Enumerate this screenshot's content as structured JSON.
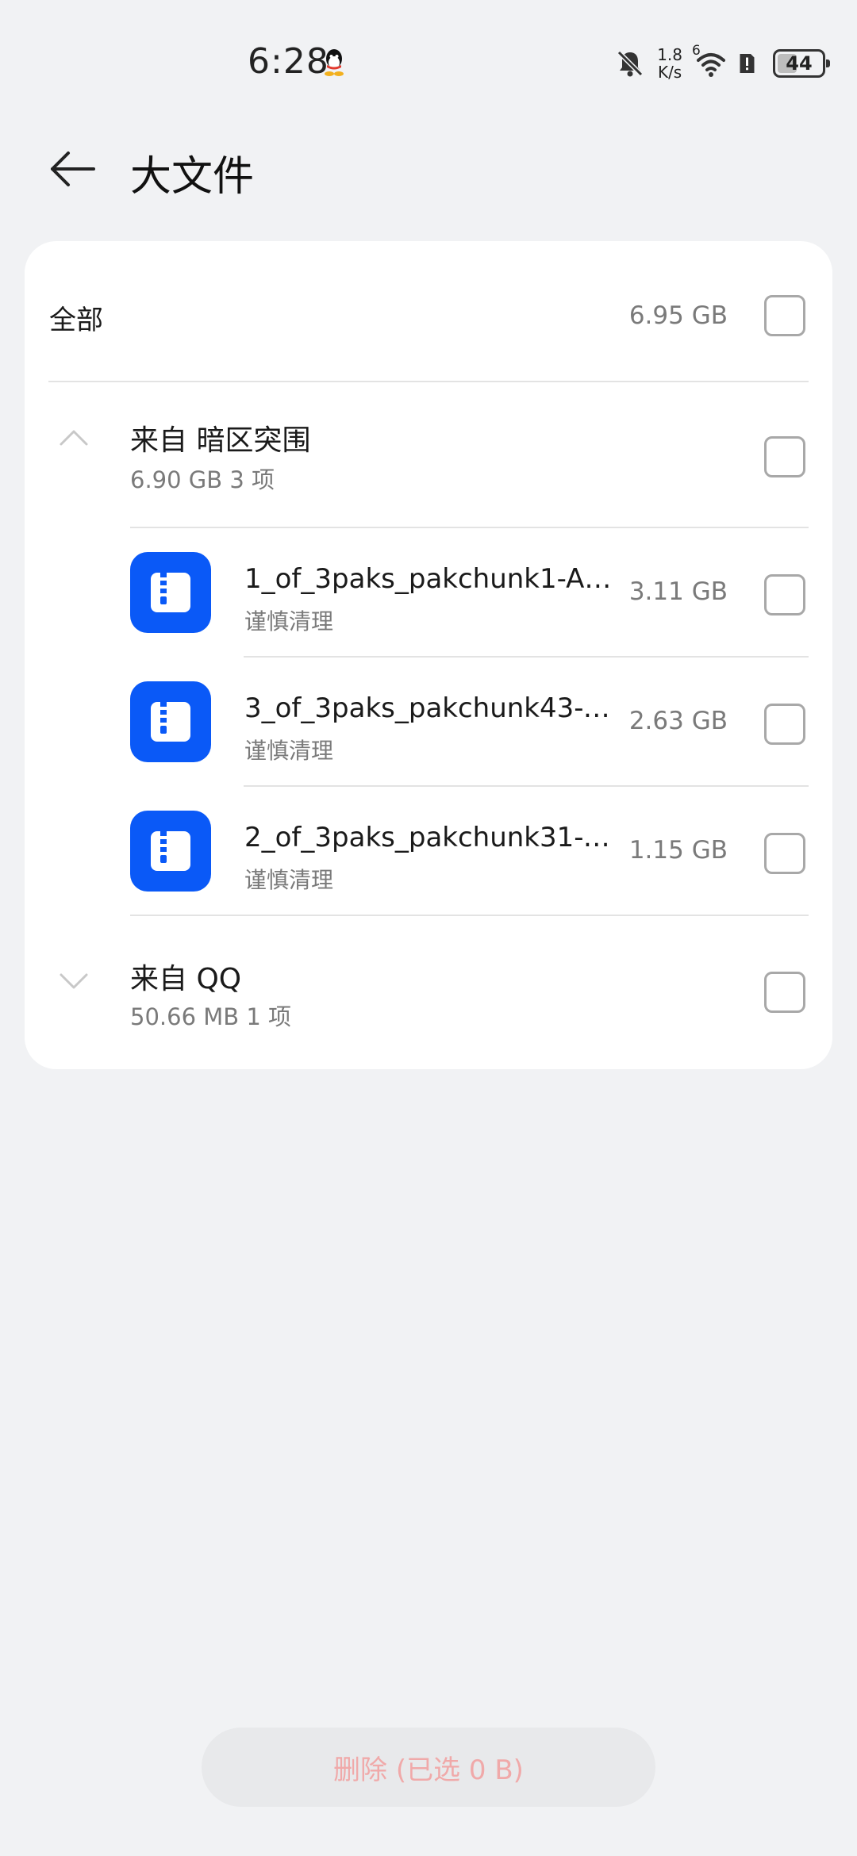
{
  "status_bar": {
    "time": "6:28",
    "net_speed_value": "1.8",
    "net_speed_unit": "K/s",
    "signal_label": "6",
    "battery_level": "44",
    "battery_percent": 44
  },
  "header": {
    "title": "大文件"
  },
  "all_row": {
    "label": "全部",
    "size": "6.95 GB",
    "checked": false
  },
  "groups": [
    {
      "title": "来自 暗区突围",
      "subtitle": "6.90 GB 3 项",
      "expanded": true,
      "files": [
        {
          "name": "1_of_3paks_pakchunk1-An...",
          "tag": "谨慎清理",
          "size": "3.11 GB",
          "icon": "zip-file-icon"
        },
        {
          "name": "3_of_3paks_pakchunk43-A...",
          "tag": "谨慎清理",
          "size": "2.63 GB",
          "icon": "zip-file-icon"
        },
        {
          "name": "2_of_3paks_pakchunk31-A...",
          "tag": "谨慎清理",
          "size": "1.15 GB",
          "icon": "zip-file-icon"
        }
      ]
    },
    {
      "title": "来自 QQ",
      "subtitle": "50.66 MB 1 项",
      "expanded": false
    }
  ],
  "footer": {
    "delete_label": "删除 (已选 0 B)"
  },
  "colors": {
    "accent": "#0a59f7",
    "background": "#f1f2f4",
    "card": "#ffffff",
    "delete_text_disabled": "#f0a9a9"
  }
}
